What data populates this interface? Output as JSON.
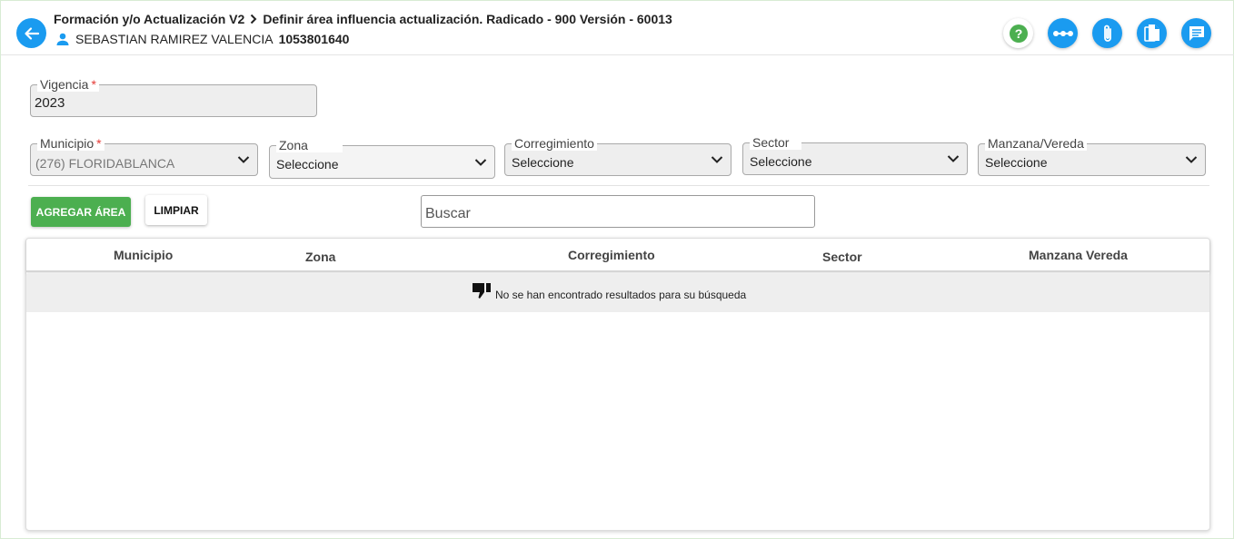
{
  "header": {
    "breadcrumb_1": "Formación y/o Actualización V2",
    "breadcrumb_2": "Definir área influencia actualización. Radicado - 900 Versión - 60013",
    "user_name": "SEBASTIAN RAMIREZ VALENCIA",
    "user_id": "1053801640",
    "actions": [
      {
        "icon": "help-icon",
        "color": "#4caf50"
      },
      {
        "icon": "more-horizontal-icon",
        "color": "#1a9bf0"
      },
      {
        "icon": "paperclip-icon",
        "color": "#1a9bf0"
      },
      {
        "icon": "copy-document-icon",
        "color": "#1a9bf0"
      },
      {
        "icon": "comment-list-icon",
        "color": "#1a9bf0"
      }
    ]
  },
  "form": {
    "vigencia": {
      "label": "Vigencia",
      "required": "*",
      "value": "2023"
    },
    "municipio": {
      "label": "Municipio",
      "required": "*",
      "value": "(276) FLORIDABLANCA"
    },
    "zona": {
      "label": "Zona",
      "value": "Seleccione"
    },
    "corregimiento": {
      "label": "Corregimiento",
      "value": "Seleccione"
    },
    "sector": {
      "label": "Sector",
      "value": "Seleccione"
    },
    "manzana": {
      "label": "Manzana/Vereda",
      "value": "Seleccione"
    }
  },
  "toolbar": {
    "add_label": "AGREGAR ÁREA",
    "clear_label": "LIMPIAR",
    "search_placeholder": "Buscar"
  },
  "table": {
    "columns": [
      "Municipio",
      "Zona",
      "Corregimiento",
      "Sector",
      "Manzana Vereda"
    ],
    "empty_message": "No se han encontrado resultados para su búsqueda"
  },
  "colors": {
    "accent": "#1a9bf0",
    "success": "#4caf50",
    "required": "#e53935"
  }
}
